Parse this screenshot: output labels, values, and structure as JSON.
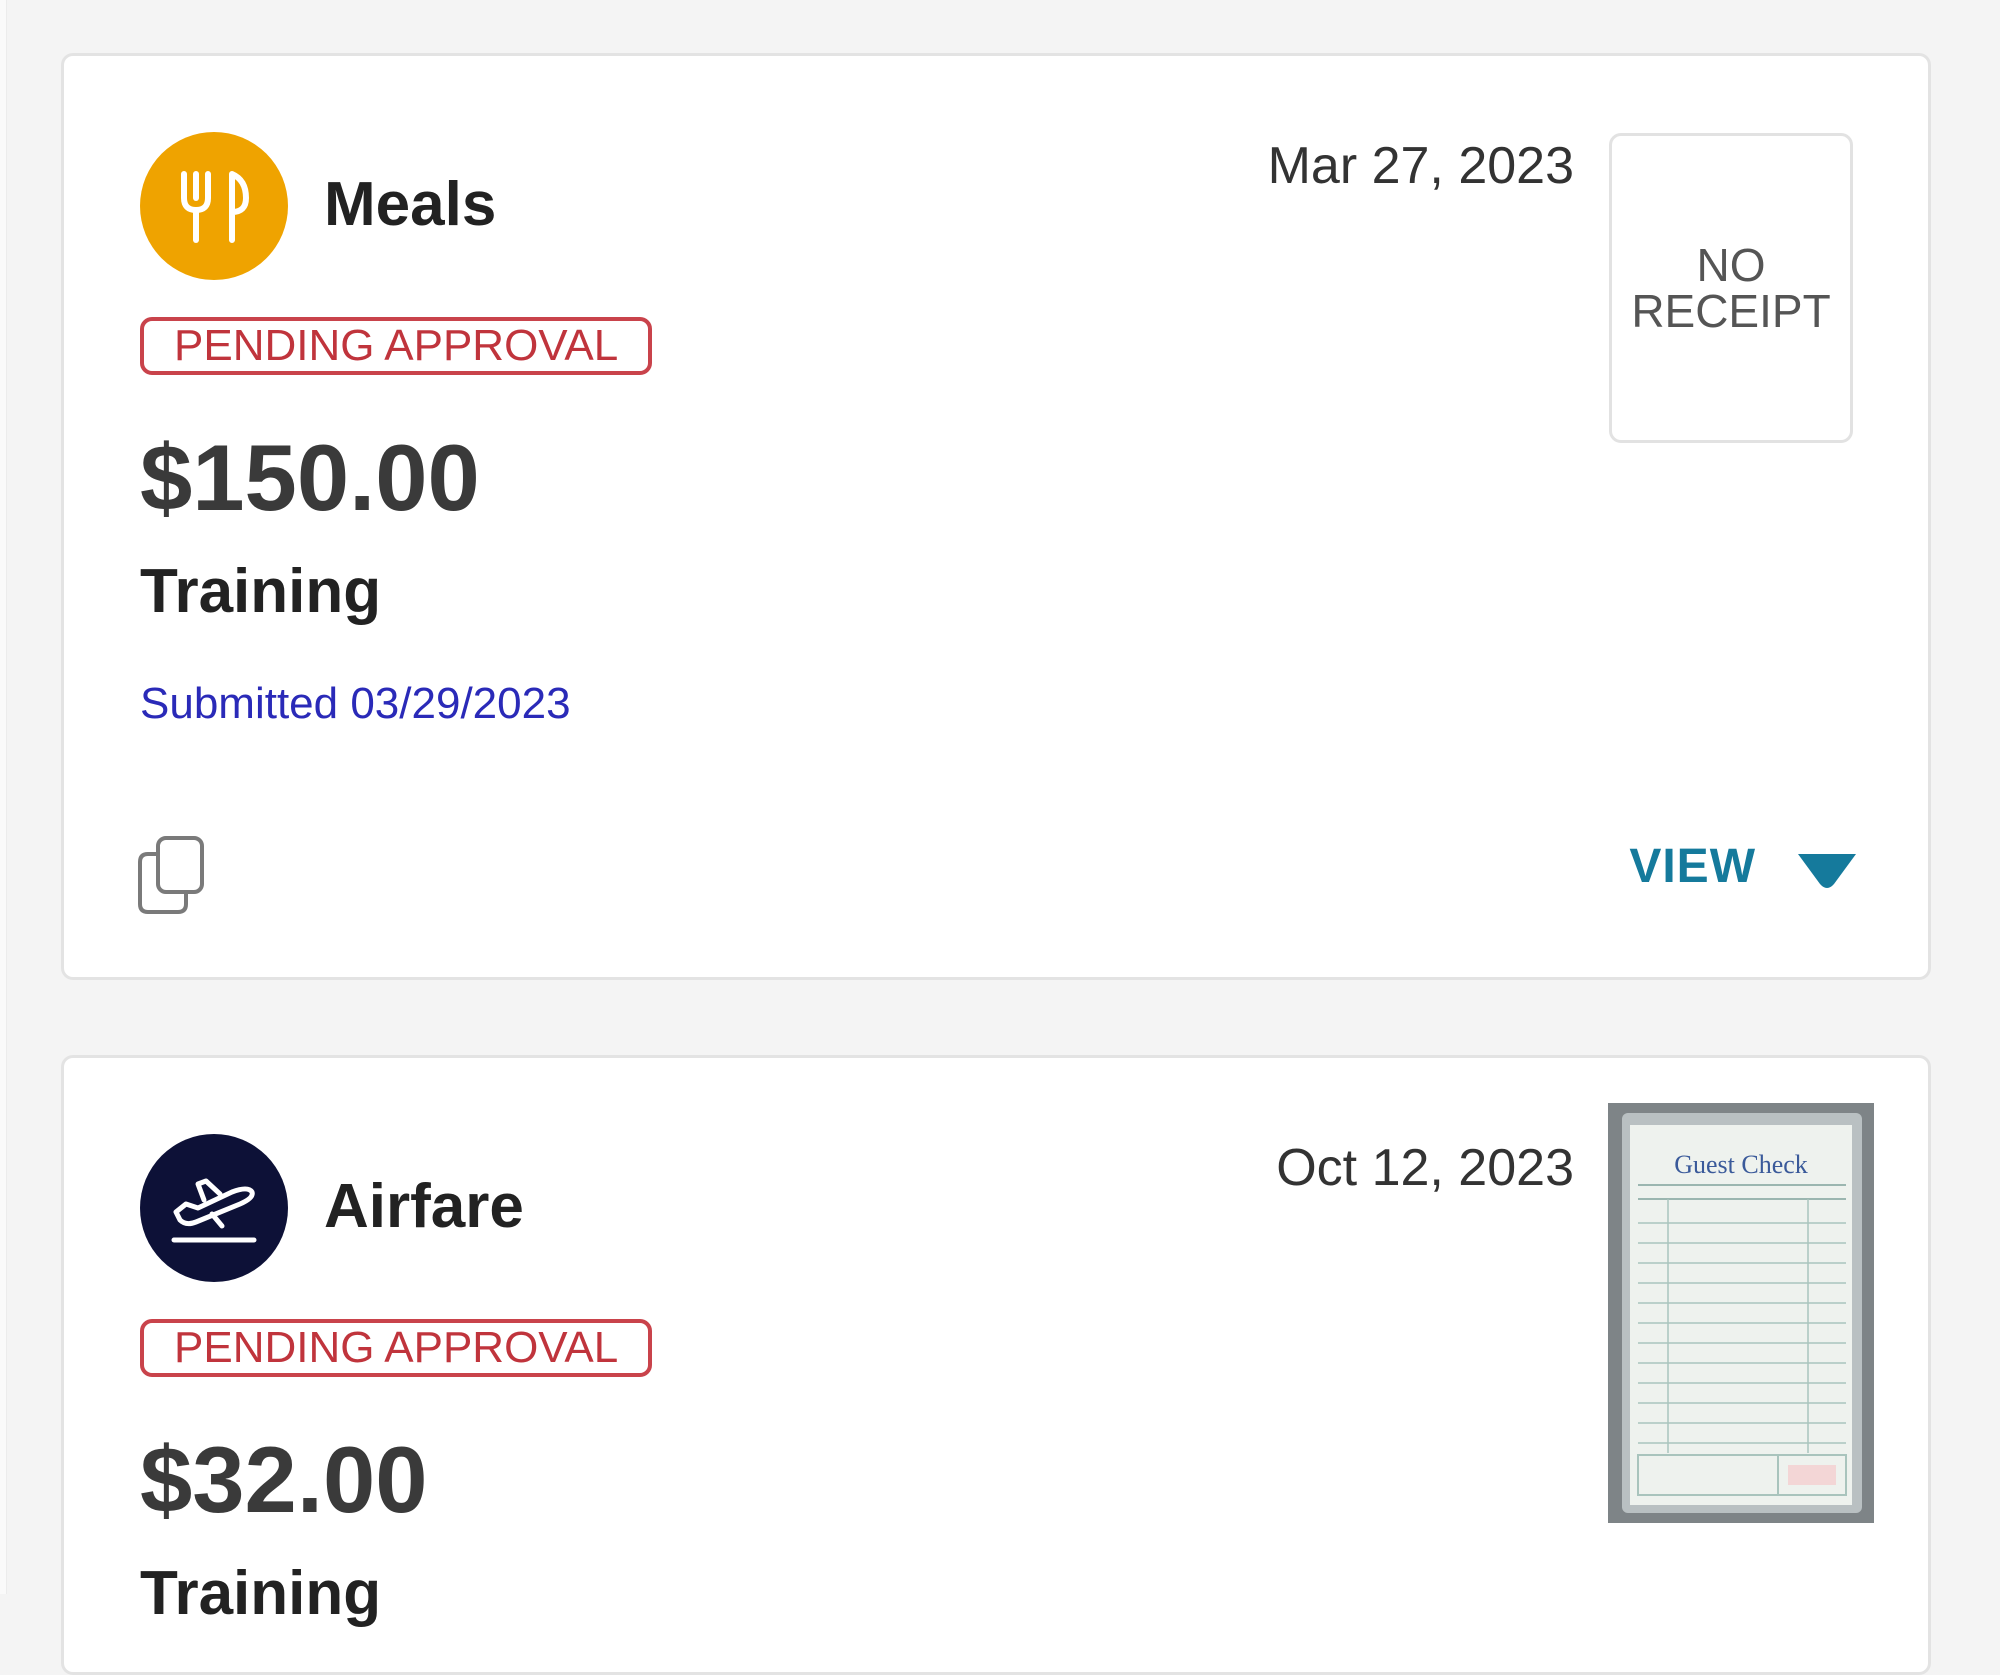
{
  "expenses": [
    {
      "category": "Meals",
      "category_icon": "fork-knife-icon",
      "icon_color": "#EFA300",
      "status": "PENDING APPROVAL",
      "status_color": "#C0343C",
      "amount": "$150.00",
      "purpose": "Training",
      "submitted": "Submitted 03/29/2023",
      "date": "Mar 27, 2023",
      "receipt": {
        "present": false,
        "placeholder_line1": "NO",
        "placeholder_line2": "RECEIPT"
      },
      "actions": {
        "copy_icon": "copy-icon",
        "view_label": "VIEW",
        "view_icon": "caret-down-icon",
        "view_color": "#157A9C"
      }
    },
    {
      "category": "Airfare",
      "category_icon": "airplane-takeoff-icon",
      "icon_color": "#0D1137",
      "status": "PENDING APPROVAL",
      "status_color": "#C0343C",
      "amount": "$32.00",
      "purpose": "Training",
      "date": "Oct 12, 2023",
      "receipt": {
        "present": true,
        "image_text": "Guest Check"
      }
    }
  ]
}
